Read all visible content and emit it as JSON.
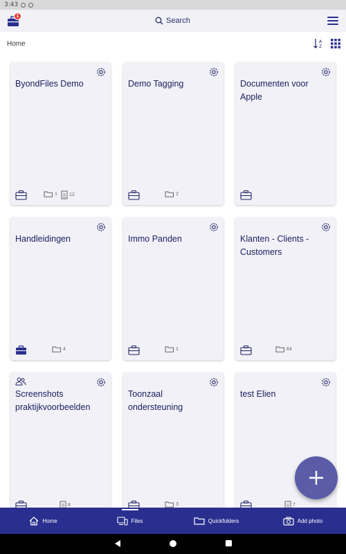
{
  "status_bar": {
    "time": "3:43"
  },
  "top_bar": {
    "notification_count": "1",
    "search_label": "Search"
  },
  "breadcrumb": {
    "current": "Home"
  },
  "folders": [
    {
      "title": "ByondFiles Demo",
      "folder_count": "1",
      "file_count": "12"
    },
    {
      "title": "Demo Tagging",
      "folder_count": "2"
    },
    {
      "title": "Documenten voor Apple"
    },
    {
      "title": "Handleidingen",
      "folder_count": "4"
    },
    {
      "title": "Immo Panden",
      "folder_count": "1"
    },
    {
      "title": "Klanten - Clients - Customers",
      "folder_count": "64"
    },
    {
      "title": "Screenshots praktijkvoorbeelden",
      "file_count": "8"
    },
    {
      "title": "Toonzaal ondersteuning",
      "folder_count": "3"
    },
    {
      "title": "test Elien",
      "file_count": "7"
    }
  ],
  "bottom_nav": {
    "items": [
      {
        "label": "Home",
        "icon": "home-icon"
      },
      {
        "label": "Files",
        "icon": "files-icon",
        "active": true
      },
      {
        "label": "Quickfolders",
        "icon": "folder-icon"
      },
      {
        "label": "Add photo",
        "icon": "camera-icon"
      }
    ]
  },
  "colors": {
    "primary": "#2a2f8f",
    "fab": "#5b5ca8",
    "card_bg": "#f1f1f7",
    "text": "#1e2060",
    "badge": "#e53935"
  }
}
